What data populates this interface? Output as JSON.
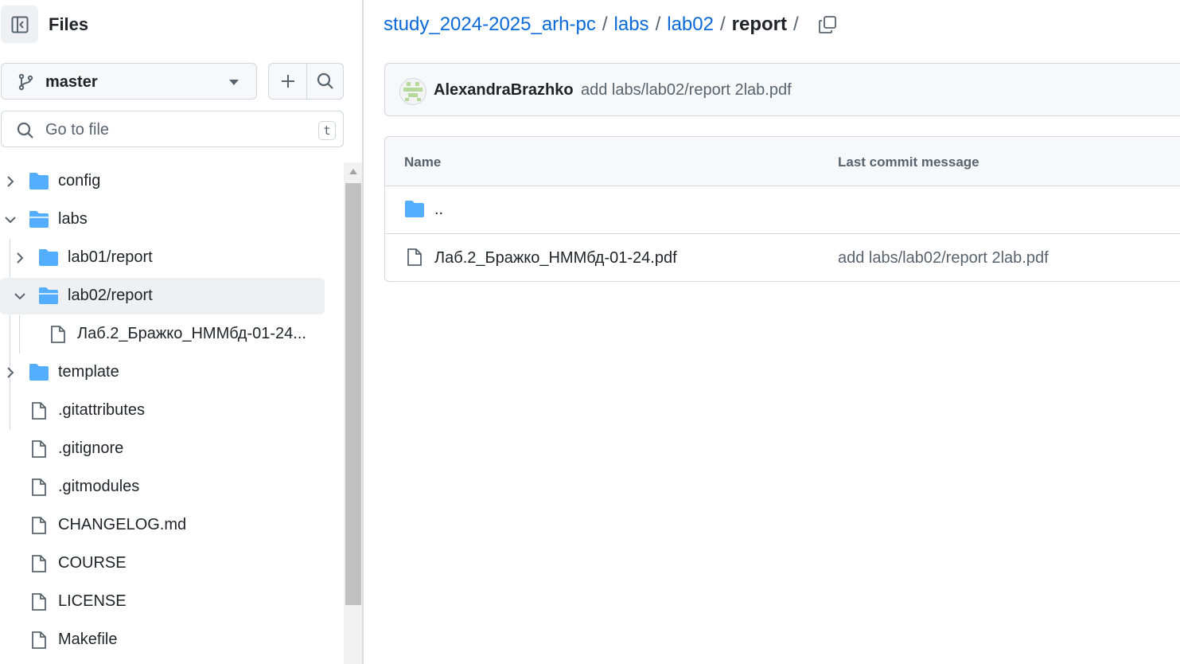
{
  "sidebar": {
    "title": "Files",
    "branch": "master",
    "goto_placeholder": "Go to file",
    "goto_shortcut": "t",
    "tree": [
      {
        "label": "config",
        "type": "folder",
        "state": "collapsed"
      },
      {
        "label": "labs",
        "type": "folder",
        "state": "expanded"
      },
      {
        "label": "lab01/report",
        "type": "folder",
        "state": "collapsed"
      },
      {
        "label": "lab02/report",
        "type": "folder",
        "state": "expanded",
        "selected": true
      },
      {
        "label": "Лаб.2_Бражко_НММбд-01-24...",
        "type": "file"
      },
      {
        "label": "template",
        "type": "folder",
        "state": "collapsed"
      },
      {
        "label": ".gitattributes",
        "type": "file"
      },
      {
        "label": ".gitignore",
        "type": "file"
      },
      {
        "label": ".gitmodules",
        "type": "file"
      },
      {
        "label": "CHANGELOG.md",
        "type": "file"
      },
      {
        "label": "COURSE",
        "type": "file"
      },
      {
        "label": "LICENSE",
        "type": "file"
      },
      {
        "label": "Makefile",
        "type": "file"
      }
    ]
  },
  "breadcrumb": {
    "repo": "study_2024-2025_arh-pc",
    "parts": [
      "labs",
      "lab02"
    ],
    "current": "report",
    "sep": "/"
  },
  "commit": {
    "author": "AlexandraBrazhko",
    "message": "add labs/lab02/report 2lab.pdf"
  },
  "table": {
    "col_name": "Name",
    "col_commit": "Last commit message",
    "parent": "..",
    "rows": [
      {
        "name": "Лаб.2_Бражко_НММбд-01-24.pdf",
        "commit": "add labs/lab02/report 2lab.pdf"
      }
    ]
  },
  "colors": {
    "link": "#0969da",
    "folder": "#54aeff",
    "text": "#1f2328",
    "muted": "#59636e"
  }
}
